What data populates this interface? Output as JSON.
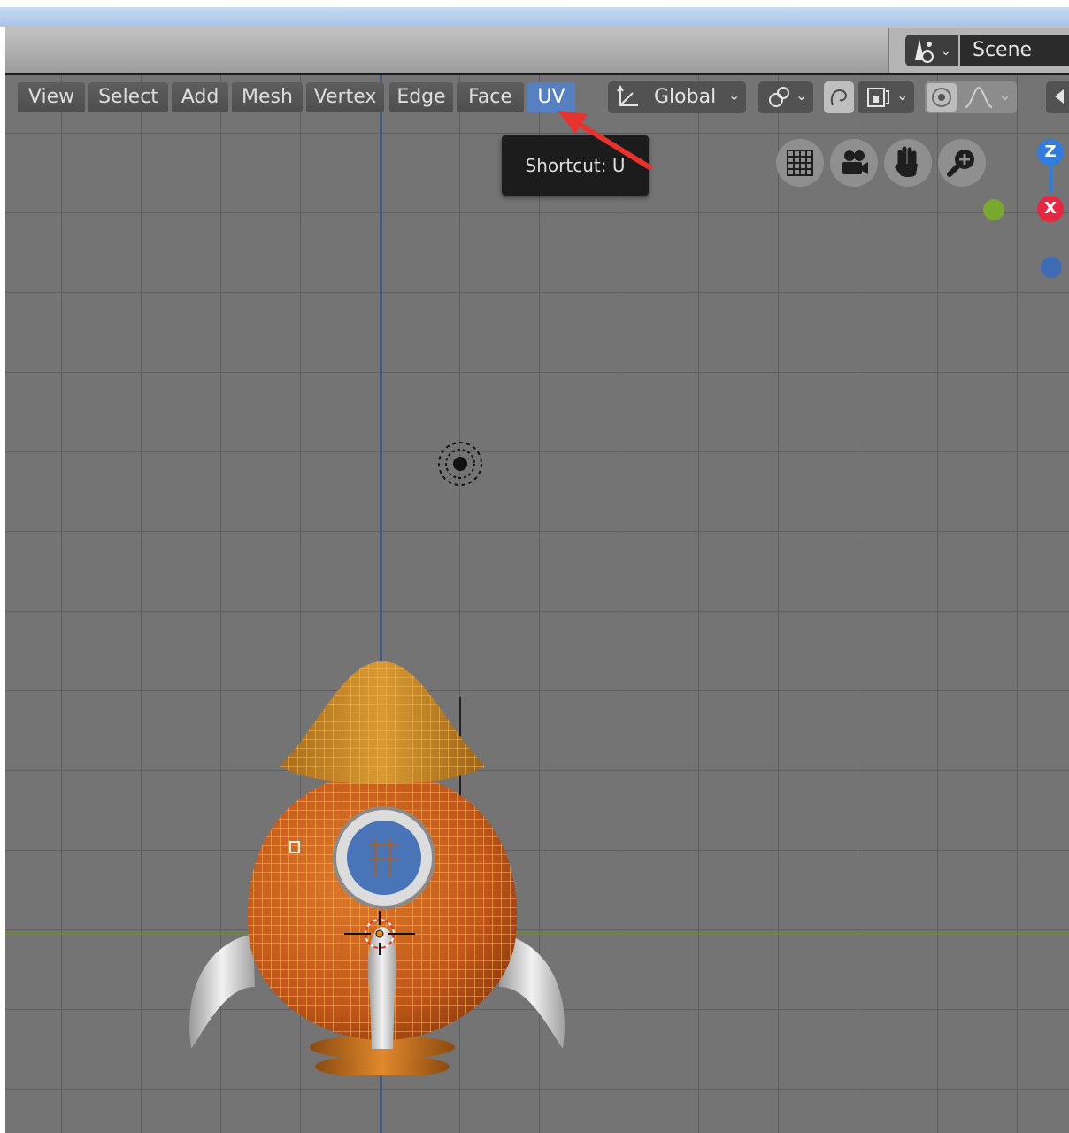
{
  "scene": {
    "label": "Scene"
  },
  "menu": [
    {
      "label": "View"
    },
    {
      "label": "Select"
    },
    {
      "label": "Add"
    },
    {
      "label": "Mesh"
    },
    {
      "label": "Vertex"
    },
    {
      "label": "Edge"
    },
    {
      "label": "Face"
    },
    {
      "label": "UV"
    }
  ],
  "transform_orientation": {
    "label": "Global"
  },
  "tooltip": {
    "text": "Shortcut: U"
  },
  "gizmo": {
    "z_label": "Z",
    "x_label": "X"
  },
  "colors": {
    "uv_active": "#5680c2",
    "arrow": "#e8322b",
    "gizmo_z": "#2f7de1",
    "gizmo_x": "#e8263f",
    "gizmo_y": "#7aa82e"
  },
  "icons": [
    "scene-icon",
    "transform-orientation-icon",
    "pivot-icon",
    "snap-icon",
    "snap-target-icon",
    "proportional-edit-icon",
    "falloff-icon",
    "grid-toggle-icon",
    "camera-view-icon",
    "pan-hand-icon",
    "zoom-icon",
    "light-icon",
    "3d-cursor-icon"
  ]
}
